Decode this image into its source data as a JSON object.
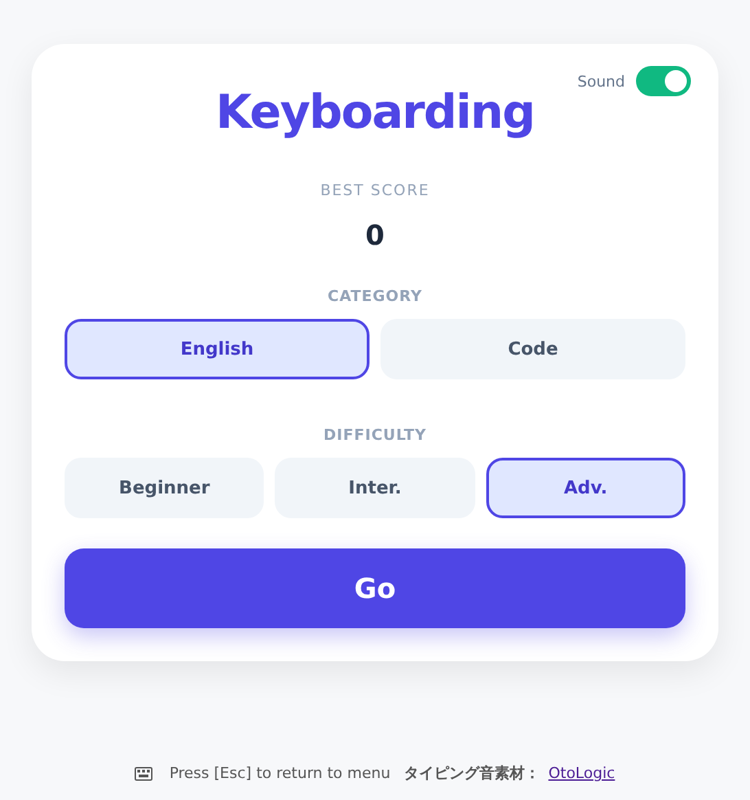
{
  "title": "Keyboarding",
  "sound": {
    "label": "Sound",
    "on": true
  },
  "best_score": {
    "label": "BEST SCORE",
    "value": "0"
  },
  "category": {
    "label": "CATEGORY",
    "options": [
      {
        "label": "English",
        "selected": true
      },
      {
        "label": "Code",
        "selected": false
      }
    ]
  },
  "difficulty": {
    "label": "DIFFICULTY",
    "options": [
      {
        "label": "Beginner",
        "selected": false
      },
      {
        "label": "Inter.",
        "selected": false
      },
      {
        "label": "Adv.",
        "selected": true
      }
    ]
  },
  "go_button": "Go",
  "footer": {
    "hint": "Press [Esc] to return to menu",
    "credit": "タイピング音素材：",
    "link": "OtoLogic"
  }
}
